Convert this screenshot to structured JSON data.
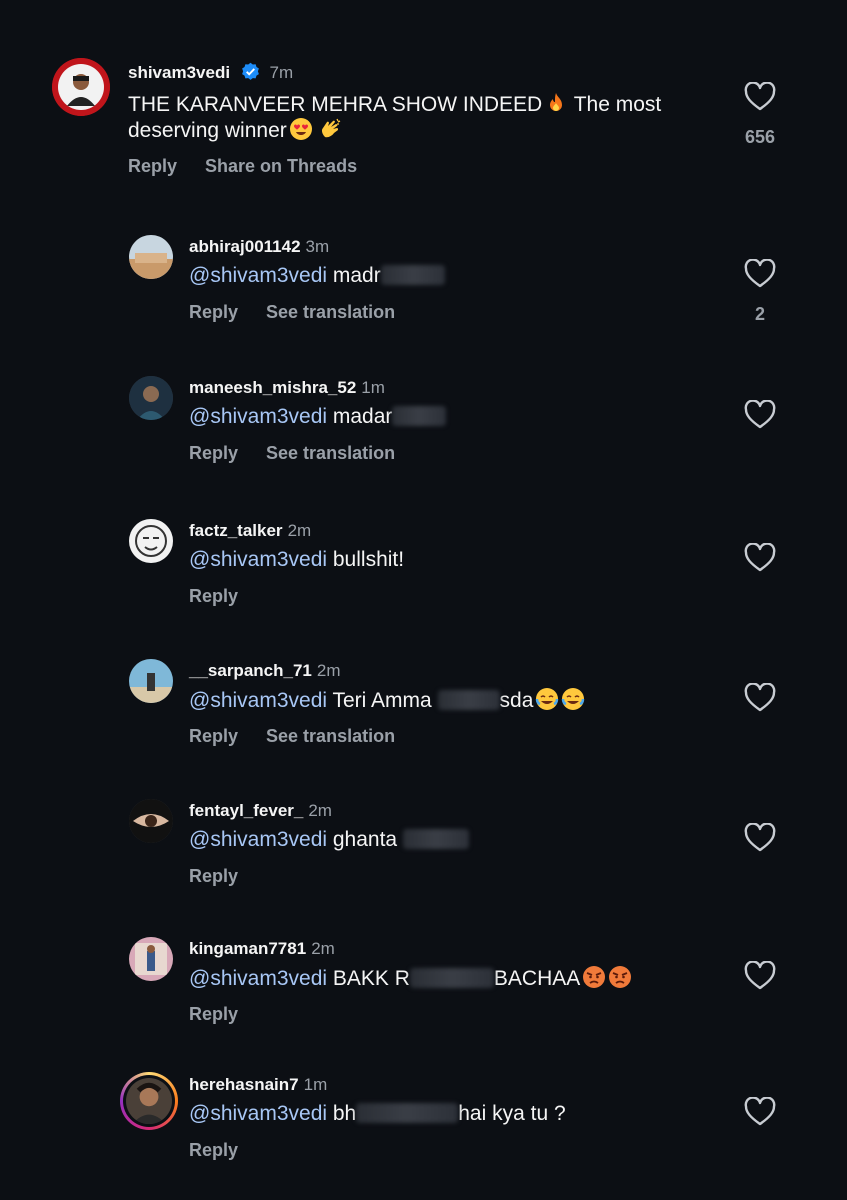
{
  "main_comment": {
    "username": "shivam3vedi",
    "time": "7m",
    "text": "THE KARANVEER MEHRA SHOW INDEED",
    "text_after_fire": " The most",
    "text_line2": "deserving winner",
    "reply_label": "Reply",
    "share_label": "Share on Threads",
    "likes": "656",
    "avatar_color": "#c0151b"
  },
  "replies": [
    {
      "username": "abhiraj001142",
      "time": "3m",
      "mention": "@shivam3vedi",
      "text": " madr",
      "text_after": "",
      "reply_label": "Reply",
      "translate_label": "See translation",
      "likes": "2"
    },
    {
      "username": "maneesh_mishra_52",
      "time": "1m",
      "mention": "@shivam3vedi",
      "text": " madar",
      "text_after": "",
      "reply_label": "Reply",
      "translate_label": "See translation",
      "likes": ""
    },
    {
      "username": "factz_talker",
      "time": "2m",
      "mention": "@shivam3vedi",
      "text": " bullshit!",
      "text_after": "",
      "reply_label": "Reply",
      "translate_label": "",
      "likes": ""
    },
    {
      "username": "__sarpanch_71",
      "time": "2m",
      "mention": "@shivam3vedi",
      "text": " Teri Amma ",
      "text_after": "sda",
      "reply_label": "Reply",
      "translate_label": "See translation",
      "likes": ""
    },
    {
      "username": "fentayl_fever_",
      "time": "2m",
      "mention": "@shivam3vedi",
      "text": " ghanta ",
      "text_after": "",
      "reply_label": "Reply",
      "translate_label": "",
      "likes": ""
    },
    {
      "username": "kingaman7781",
      "time": "2m",
      "mention": "@shivam3vedi",
      "text": " BAKK R",
      "text_after": "BACHAA",
      "reply_label": "Reply",
      "translate_label": "",
      "likes": ""
    },
    {
      "username": "herehasnain7",
      "time": "1m",
      "mention": "@shivam3vedi",
      "text": " bh",
      "text_after": "hai kya tu ?",
      "reply_label": "Reply",
      "translate_label": "",
      "likes": ""
    }
  ],
  "colors": {
    "background": "#0c0f14",
    "mention": "#a8c7f5",
    "muted": "#9aa0a8",
    "verified": "#1d8cf8",
    "story_ring": "#e1306c"
  },
  "icons": {
    "heart": "heart-outline-icon",
    "verified": "verified-badge-icon",
    "fire": "fire-emoji",
    "heart_eyes": "heart-eyes-emoji",
    "clap": "clapping-hands-emoji",
    "laugh": "tears-of-joy-emoji",
    "angry": "angry-face-emoji"
  }
}
